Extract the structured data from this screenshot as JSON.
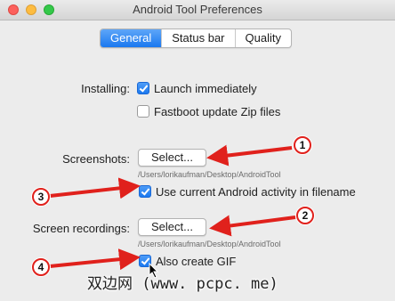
{
  "window": {
    "title": "Android Tool Preferences"
  },
  "tabs": [
    {
      "label": "General",
      "active": true
    },
    {
      "label": "Status bar",
      "active": false
    },
    {
      "label": "Quality",
      "active": false
    }
  ],
  "installing": {
    "label": "Installing:",
    "launch_immediately": {
      "label": "Launch immediately",
      "checked": true
    },
    "fastboot_update": {
      "label": "Fastboot update Zip files",
      "checked": false
    }
  },
  "screenshots": {
    "label": "Screenshots:",
    "button_label": "Select...",
    "path": "/Users/lorikaufman/Desktop/AndroidTool",
    "use_activity_name": {
      "label": "Use current Android activity in filename",
      "checked": true
    }
  },
  "screen_recordings": {
    "label": "Screen recordings:",
    "button_label": "Select...",
    "path": "/Users/lorikaufman/Desktop/AndroidTool",
    "also_create_gif": {
      "label": "Also create GIF",
      "checked": true
    }
  },
  "callouts": [
    "1",
    "2",
    "3",
    "4"
  ],
  "watermark": "双边网 (www. pcpc. me)",
  "colors": {
    "accent": "#1a78f0",
    "callout_red": "#e0211c"
  }
}
